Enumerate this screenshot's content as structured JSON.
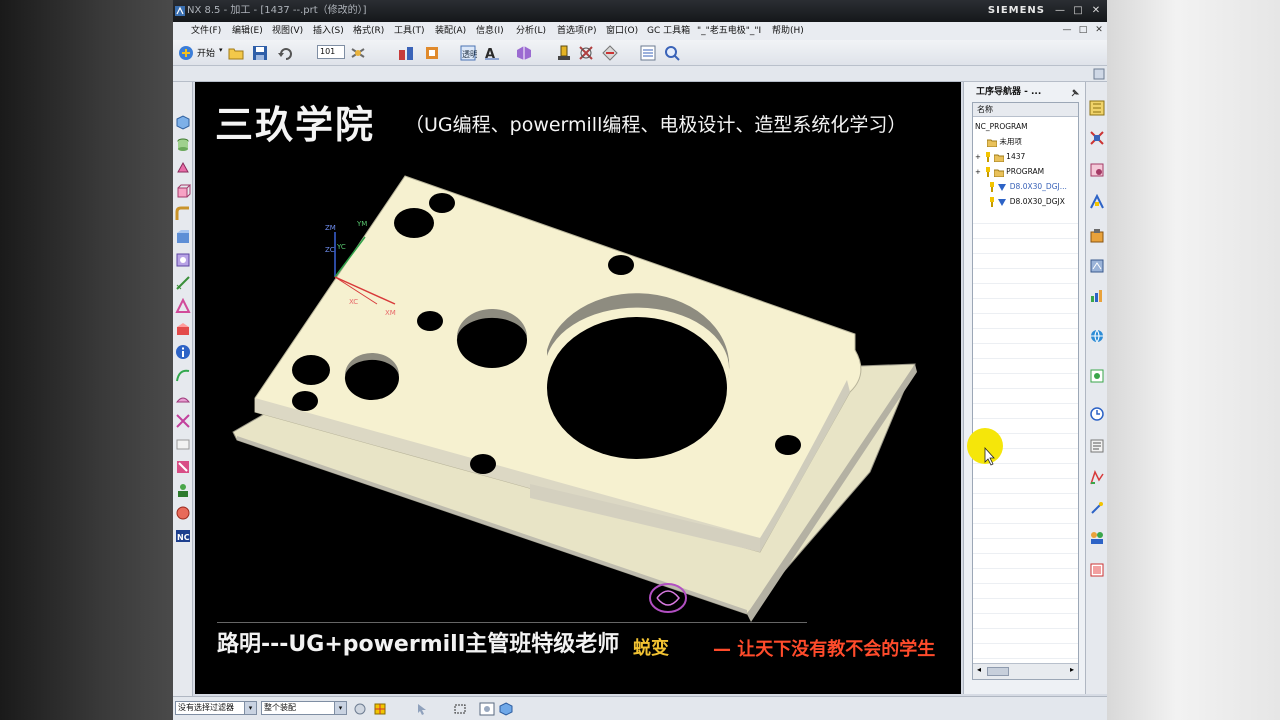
{
  "window": {
    "title": "NX 8.5 - 加工 - [1437 --.prt（修改的）]",
    "brand": "SIEMENS",
    "controls": [
      "—",
      "□",
      "✕"
    ]
  },
  "menubar": {
    "items": [
      "文件(F)",
      "编辑(E)",
      "视图(V)",
      "插入(S)",
      "格式(R)",
      "工具(T)",
      "装配(A)",
      "信息(I)",
      "分析(L)",
      "首选项(P)",
      "窗口(O)",
      "GC 工具箱",
      "\"_\"老五电极\"_\"I",
      "帮助(H)"
    ],
    "mdi_controls": [
      "—",
      "□",
      "✕"
    ]
  },
  "toolbar": {
    "start_label": "开始",
    "start_arrow": "▾",
    "combo_value": "101",
    "combo_arrow": "▾"
  },
  "viewport": {
    "title_big": "三玖学院",
    "title_small": "（UG编程、powermill编程、电极设计、造型系统化学习）",
    "teacher": "路明---UG+powermill主管班特级老师",
    "slogan_a": "蜕变",
    "slogan_b": "— 让天下没有教不会的学生",
    "axes": [
      "ZM",
      "YM",
      "ZC",
      "YC",
      "XC",
      "XM"
    ]
  },
  "navigator": {
    "title": "工序导航器 - ...",
    "column": "名称",
    "rows": [
      {
        "label": "NC_PROGRAM",
        "indent": 0,
        "expander": ""
      },
      {
        "label": "未用项",
        "indent": 1,
        "expander": ""
      },
      {
        "label": "1437",
        "indent": 1,
        "expander": "+"
      },
      {
        "label": "PROGRAM",
        "indent": 1,
        "expander": "+"
      },
      {
        "label": "D8.0X30_DGJ...",
        "indent": 2,
        "expander": ""
      },
      {
        "label": "D8.0X30_DGJX",
        "indent": 2,
        "expander": ""
      }
    ],
    "scroll_left": "◂",
    "scroll_right": "▸"
  },
  "statusbar": {
    "filter_value": "没有选择过滤器",
    "assembly_value": "整个装配",
    "dropdown_arrow": "▾"
  },
  "colors": {
    "part_top": "#f6f1d0",
    "part_side": "#d9d6c4",
    "cursor_highlight": "#f5e60a",
    "slogan_red": "#ff4b2b",
    "slogan_gold": "#f1c232"
  }
}
